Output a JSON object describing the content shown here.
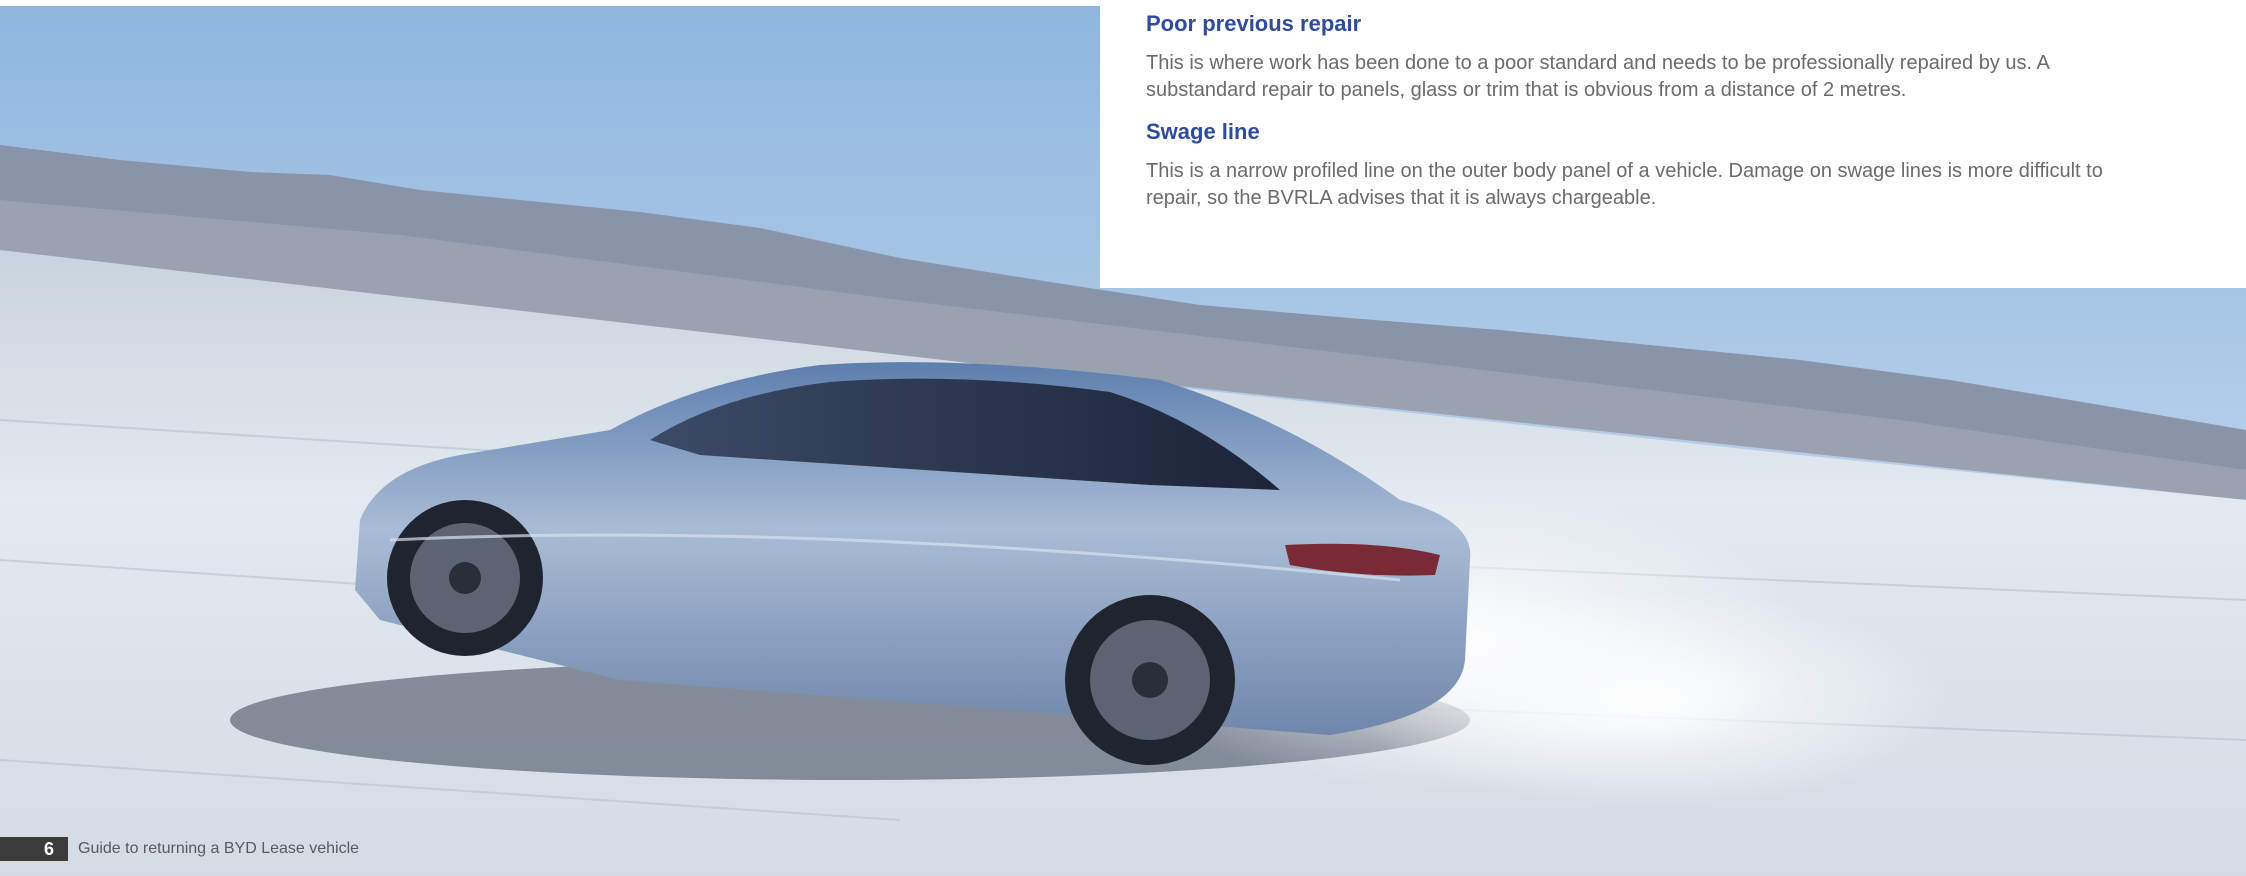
{
  "sections": [
    {
      "heading": "Poor previous repair",
      "body": "This is where work has been done to a poor standard and needs to be professionally repaired by us. A substandard repair to panels, glass or trim that is obvious from a distance of 2 metres."
    },
    {
      "heading": "Swage line",
      "body": "This is a narrow profiled line on the outer body panel of a vehicle. Damage on swage lines is more difficult to repair, so the BVRLA advises that it is always chargeable."
    }
  ],
  "footer": {
    "page_number": "6",
    "title": "Guide to returning a BYD Lease vehicle"
  },
  "colors": {
    "heading": "#2f4b9b",
    "body_text": "#6b6b6b",
    "page_number_bg": "#3c3c3c"
  }
}
